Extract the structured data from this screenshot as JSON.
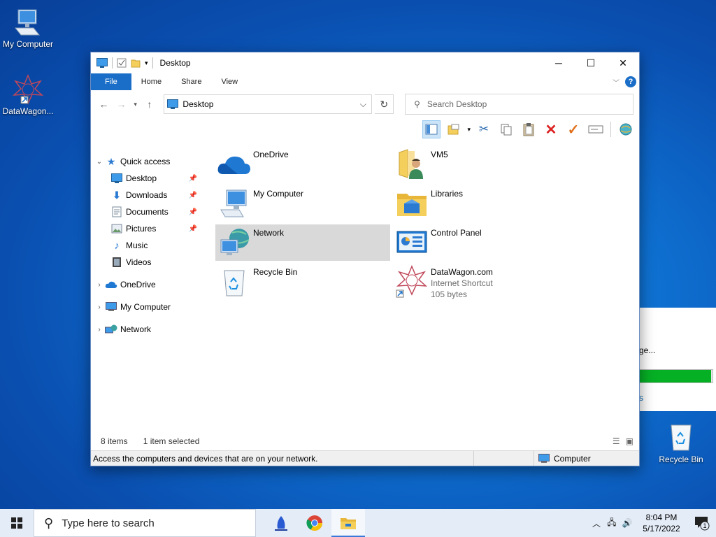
{
  "desktop": {
    "icons": [
      {
        "label": "My Computer",
        "icon": "monitor-icon"
      },
      {
        "label": "DataWagon...",
        "icon": "datawagon-shortcut-icon"
      },
      {
        "label": "Recycle Bin",
        "icon": "recycle-bin-icon"
      }
    ]
  },
  "window": {
    "title": "Desktop",
    "tabs": [
      "File",
      "Home",
      "Share",
      "View"
    ],
    "address": "Desktop",
    "search_placeholder": "Search Desktop",
    "nav": {
      "quick_access": "Quick access",
      "quick_items": [
        {
          "label": "Desktop",
          "pinned": true
        },
        {
          "label": "Downloads",
          "pinned": true
        },
        {
          "label": "Documents",
          "pinned": true
        },
        {
          "label": "Pictures",
          "pinned": true
        },
        {
          "label": "Music",
          "pinned": false
        },
        {
          "label": "Videos",
          "pinned": false
        }
      ],
      "roots": [
        "OneDrive",
        "My Computer",
        "Network"
      ]
    },
    "items": [
      {
        "name": "OneDrive",
        "icon": "onedrive-cloud-icon"
      },
      {
        "name": "VM5",
        "icon": "user-folder-icon"
      },
      {
        "name": "My Computer",
        "icon": "monitor-icon"
      },
      {
        "name": "Libraries",
        "icon": "libraries-folder-icon"
      },
      {
        "name": "Network",
        "icon": "network-globe-icon",
        "selected": true
      },
      {
        "name": "Control Panel",
        "icon": "control-panel-icon"
      },
      {
        "name": "Recycle Bin",
        "icon": "recycle-bin-icon"
      },
      {
        "name": "DataWagon.com",
        "icon": "datawagon-shortcut-icon",
        "type": "Internet Shortcut",
        "size": "105 bytes"
      }
    ],
    "status": {
      "count": "8 items",
      "selected": "1 item selected",
      "info": "Access the computers and devices that are on your network.",
      "location": "Computer"
    }
  },
  "background_dialog": {
    "partial_text": "ge...",
    "progress": 0.98,
    "partial_link": "s"
  },
  "taskbar": {
    "search_placeholder": "Type here to search",
    "apps": [
      "bird-app-icon",
      "chrome-icon",
      "file-explorer-icon"
    ],
    "time": "8:04 PM",
    "date": "5/17/2022",
    "notifications": "1"
  },
  "colors": {
    "accent": "#1a6ec7",
    "selection": "#d9d9d9",
    "progress": "#06b025"
  }
}
